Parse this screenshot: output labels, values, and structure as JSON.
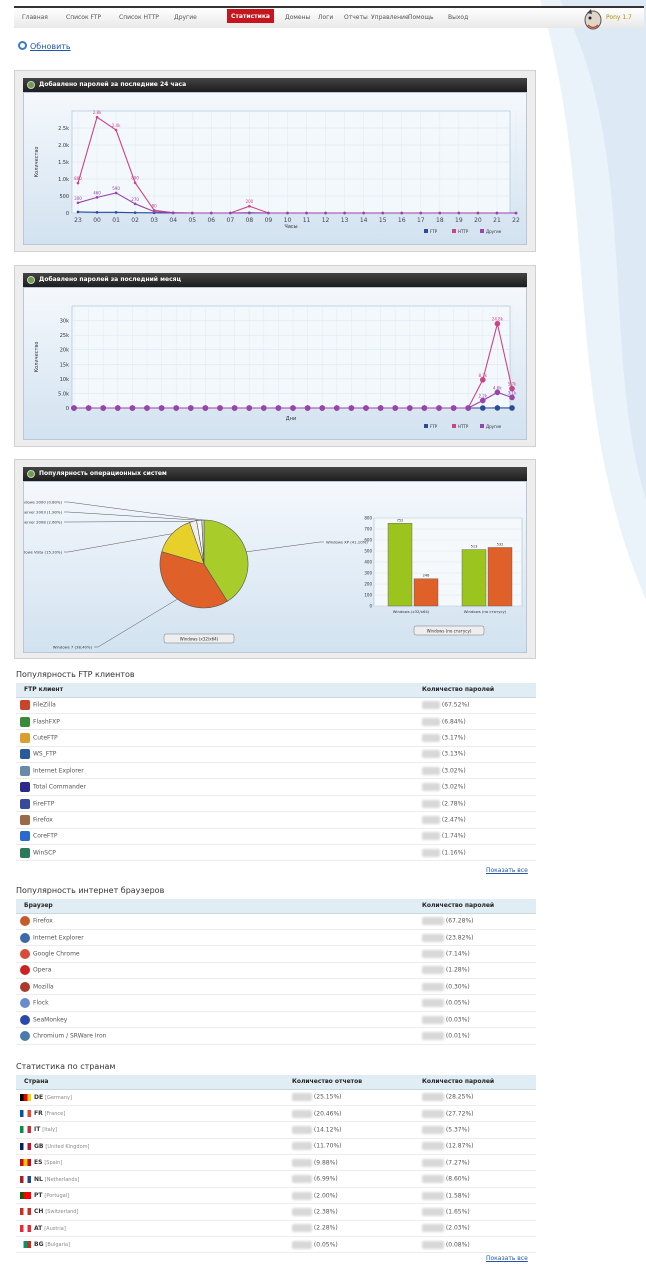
{
  "nav": {
    "items": [
      "Главная",
      "Список FTP",
      "Список HTTP",
      "Другие",
      "Статистика",
      "Домены",
      "Логи",
      "Отчеты",
      "Управление",
      "Помощь",
      "Выход"
    ],
    "active": "Статистика"
  },
  "brand": {
    "text": "Pony 1.7"
  },
  "refresh": {
    "label": "Обновить"
  },
  "colors": {
    "ftp": "#2a4a9a",
    "http": "#cc4488",
    "other": "#9944aa",
    "header": "#1d1d1d",
    "active_tab": "#c4161c"
  },
  "panel_hourly": {
    "title": "Добавлено паролей за последние 24 часа"
  },
  "panel_monthly": {
    "title": "Добавлено паролей за последний месяц"
  },
  "panel_os": {
    "title": "Популярность операционных систем",
    "pie_button": "Windows (x32/x64)",
    "bar_button": "Windows (по статусу)"
  },
  "chart_data": [
    {
      "type": "line",
      "title": "Добавлено паролей за последние 24 часа",
      "xlabel": "Часы",
      "ylabel": "Количество",
      "x": [
        "23",
        "00",
        "01",
        "02",
        "03",
        "04",
        "05",
        "06",
        "07",
        "08",
        "09",
        "10",
        "11",
        "12",
        "13",
        "14",
        "15",
        "16",
        "17",
        "18",
        "19",
        "20",
        "21",
        "22"
      ],
      "ylim": [
        0,
        3000
      ],
      "yticks": [
        "0",
        "500",
        "1.0k",
        "1.5k",
        "2.0k",
        "2.5k"
      ],
      "grid": true,
      "legend": "bottom-right",
      "series": [
        {
          "name": "FTP",
          "color": "#2a4a9a",
          "values": [
            30,
            20,
            20,
            10,
            5,
            0,
            0,
            0,
            0,
            0,
            0,
            0,
            0,
            0,
            0,
            0,
            0,
            0,
            0,
            0,
            0,
            0,
            0,
            0
          ]
        },
        {
          "name": "HTTP",
          "color": "#cc4488",
          "values": [
            880,
            2820,
            2440,
            890,
            80,
            10,
            0,
            0,
            0,
            200,
            0,
            0,
            0,
            0,
            0,
            0,
            0,
            0,
            0,
            0,
            0,
            0,
            0,
            0
          ]
        },
        {
          "name": "Другие",
          "color": "#9944aa",
          "values": [
            300,
            460,
            590,
            270,
            40,
            5,
            0,
            0,
            0,
            10,
            0,
            0,
            0,
            0,
            0,
            0,
            0,
            0,
            0,
            0,
            0,
            0,
            0,
            0
          ]
        }
      ]
    },
    {
      "type": "line",
      "title": "Добавлено паролей за последний месяц",
      "xlabel": "Дни",
      "ylabel": "Количество",
      "ylim": [
        0,
        30000
      ],
      "yticks": [
        "0",
        "5.0k",
        "10k",
        "15k",
        "20k",
        "25k",
        "30k"
      ],
      "grid": true,
      "legend": "bottom-right",
      "series": [
        {
          "name": "FTP",
          "color": "#2a4a9a",
          "values": [
            0,
            0,
            0,
            0,
            0,
            0,
            0,
            0,
            0,
            0,
            0,
            0,
            0,
            0,
            0,
            0,
            0,
            0,
            0,
            0,
            0,
            0,
            0,
            0,
            0,
            0,
            0,
            0,
            0,
            20,
            10
          ]
        },
        {
          "name": "HTTP",
          "color": "#cc4488",
          "values": [
            0,
            0,
            0,
            0,
            0,
            0,
            0,
            0,
            0,
            0,
            0,
            0,
            0,
            0,
            0,
            0,
            0,
            0,
            0,
            0,
            0,
            0,
            0,
            0,
            0,
            0,
            0,
            0,
            8300,
            24800,
            5700
          ]
        },
        {
          "name": "Другие",
          "color": "#9944aa",
          "values": [
            0,
            0,
            0,
            0,
            0,
            0,
            0,
            0,
            0,
            0,
            0,
            0,
            0,
            0,
            0,
            0,
            0,
            0,
            0,
            0,
            0,
            0,
            0,
            0,
            0,
            0,
            0,
            0,
            2200,
            4600,
            3100
          ]
        }
      ]
    },
    {
      "type": "pie",
      "title": "Популярность операционных систем",
      "labels": [
        "Windows XP",
        "Windows 7",
        "Windows Vista",
        "Windows Server 2008",
        "Windows Server 2003",
        "Windows 2000"
      ],
      "values": [
        41.1,
        38.4,
        15.2,
        2.6,
        1.9,
        0.8
      ],
      "colors": [
        "#a8cc2a",
        "#e0602a",
        "#e8d02a",
        "#f0f0f0",
        "#f8f8f8",
        "#dddddd"
      ]
    },
    {
      "type": "bar",
      "categories": [
        "Windows (x32/x64)",
        "Windows (по статусу)"
      ],
      "series": [
        {
          "color": "#9cc41e",
          "values": [
            752,
            513
          ]
        },
        {
          "color": "#e0602a",
          "values": [
            248,
            532
          ]
        }
      ],
      "ylim": [
        0,
        800
      ],
      "yticks": [
        "0",
        "100",
        "200",
        "300",
        "400",
        "500",
        "600",
        "700",
        "800"
      ]
    }
  ],
  "ftp_clients": {
    "title": "Популярность FTP клиентов",
    "col1": "FTP клиент",
    "col2": "Количество паролей",
    "rows": [
      {
        "name": "FileZilla",
        "pct": "(67.52%)",
        "color": "#c8442a"
      },
      {
        "name": "FlashFXP",
        "pct": "(6.84%)",
        "color": "#3a8a3a"
      },
      {
        "name": "CuteFTP",
        "pct": "(3.17%)",
        "color": "#d8a030"
      },
      {
        "name": "WS_FTP",
        "pct": "(3.13%)",
        "color": "#2a5a9a"
      },
      {
        "name": "Internet Explorer",
        "pct": "(3.02%)",
        "color": "#6a8aaa"
      },
      {
        "name": "Total Commander",
        "pct": "(3.02%)",
        "color": "#2a2a8a"
      },
      {
        "name": "FireFTP",
        "pct": "(2.78%)",
        "color": "#3a4a9a"
      },
      {
        "name": "Firefox",
        "pct": "(2.47%)",
        "color": "#9a6a4a"
      },
      {
        "name": "CoreFTP",
        "pct": "(1.74%)",
        "color": "#2a6acc"
      },
      {
        "name": "WinSCP",
        "pct": "(1.16%)",
        "color": "#2a7a5a"
      }
    ],
    "show_all": "Показать все"
  },
  "browsers": {
    "title": "Популярность интернет браузеров",
    "col1": "Браузер",
    "col2": "Количество паролей",
    "rows": [
      {
        "name": "Firefox",
        "pct": "(67.28%)",
        "color": "#c85a2a"
      },
      {
        "name": "Internet Explorer",
        "pct": "(23.82%)",
        "color": "#3a6aaa"
      },
      {
        "name": "Google Chrome",
        "pct": "(7.14%)",
        "color": "#d84a3a"
      },
      {
        "name": "Opera",
        "pct": "(1.28%)",
        "color": "#cc2222"
      },
      {
        "name": "Mozilla",
        "pct": "(0.30%)",
        "color": "#aa3a2a"
      },
      {
        "name": "Flock",
        "pct": "(0.05%)",
        "color": "#6a8acc"
      },
      {
        "name": "SeaMonkey",
        "pct": "(0.03%)",
        "color": "#2a4aaa"
      },
      {
        "name": "Chromium / SRWare Iron",
        "pct": "(0.01%)",
        "color": "#4a7aaa"
      }
    ]
  },
  "countries": {
    "title": "Статистика по странам",
    "col1": "Страна",
    "col2": "Количество отчетов",
    "col3": "Количество паролей",
    "rows": [
      {
        "code": "DE",
        "name": "[Germany]",
        "reports": "(25.15%)",
        "passwords": "(28.25%)",
        "f1": "#000",
        "f2": "#dd0000",
        "f3": "#ffcc00"
      },
      {
        "code": "FR",
        "name": "[France]",
        "reports": "(20.46%)",
        "passwords": "(27.72%)",
        "f1": "#0055a4",
        "f2": "#ffffff",
        "f3": "#ef4135"
      },
      {
        "code": "IT",
        "name": "[Italy]",
        "reports": "(14.12%)",
        "passwords": "(5.37%)",
        "f1": "#009246",
        "f2": "#ffffff",
        "f3": "#ce2b37"
      },
      {
        "code": "GB",
        "name": "[United Kingdom]",
        "reports": "(11.70%)",
        "passwords": "(12.87%)",
        "f1": "#012169",
        "f2": "#ffffff",
        "f3": "#c8102e"
      },
      {
        "code": "ES",
        "name": "[Spain]",
        "reports": "(9.88%)",
        "passwords": "(7.27%)",
        "f1": "#c60b1e",
        "f2": "#ffc400",
        "f3": "#c60b1e"
      },
      {
        "code": "NL",
        "name": "[Netherlands]",
        "reports": "(6.99%)",
        "passwords": "(8.60%)",
        "f1": "#ae1c28",
        "f2": "#ffffff",
        "f3": "#21468b"
      },
      {
        "code": "PT",
        "name": "[Portugal]",
        "reports": "(2.00%)",
        "passwords": "(1.58%)",
        "f1": "#006600",
        "f2": "#ff0000",
        "f3": "#ff0000"
      },
      {
        "code": "CH",
        "name": "[Switzerland]",
        "reports": "(2.38%)",
        "passwords": "(1.65%)",
        "f1": "#d52b1e",
        "f2": "#ffffff",
        "f3": "#d52b1e"
      },
      {
        "code": "AT",
        "name": "[Austria]",
        "reports": "(2.28%)",
        "passwords": "(2.03%)",
        "f1": "#ed2939",
        "f2": "#ffffff",
        "f3": "#ed2939"
      },
      {
        "code": "BG",
        "name": "[Bulgaria]",
        "reports": "(0.05%)",
        "passwords": "(0.08%)",
        "f1": "#ffffff",
        "f2": "#00966e",
        "f3": "#d62612"
      }
    ],
    "show_all": "Показать все"
  }
}
